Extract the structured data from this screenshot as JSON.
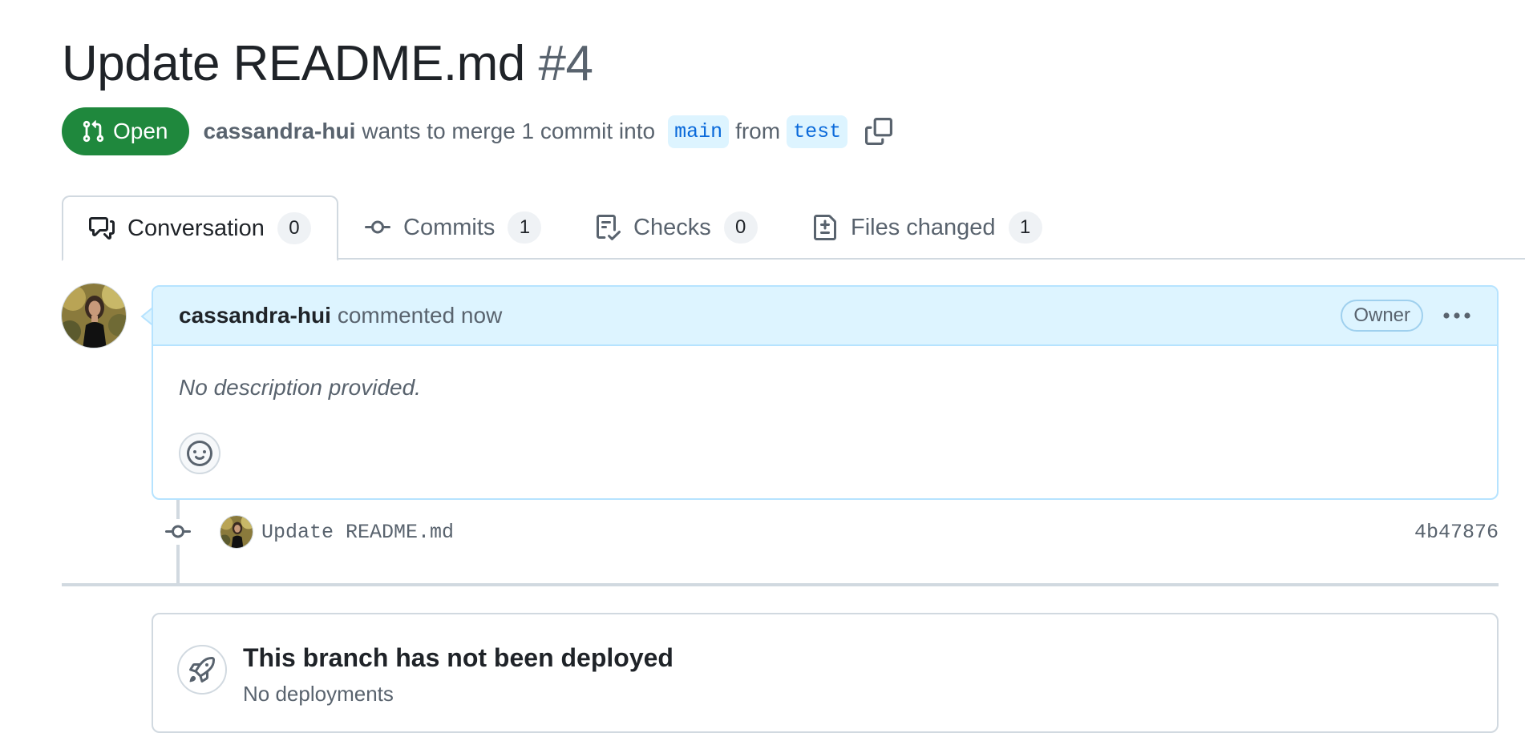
{
  "pr": {
    "title": "Update README.md",
    "number": "#4",
    "state": "Open",
    "author": "cassandra-hui",
    "action_text": "wants to merge 1 commit into",
    "base_branch": "main",
    "from_text": "from",
    "head_branch": "test"
  },
  "tabs": [
    {
      "label": "Conversation",
      "count": "0",
      "icon": "comment-discussion-icon"
    },
    {
      "label": "Commits",
      "count": "1",
      "icon": "git-commit-icon"
    },
    {
      "label": "Checks",
      "count": "0",
      "icon": "checklist-icon"
    },
    {
      "label": "Files changed",
      "count": "1",
      "icon": "file-diff-icon"
    }
  ],
  "comment": {
    "author": "cassandra-hui",
    "meta": "commented now",
    "role_badge": "Owner",
    "body": "No description provided."
  },
  "commit": {
    "message": "Update README.md",
    "sha": "4b47876"
  },
  "deployment": {
    "title": "This branch has not been deployed",
    "subtitle": "No deployments"
  },
  "colors": {
    "open_green": "#1f883d",
    "branch_blue": "#0969da",
    "branch_bg": "#ddf4ff",
    "comment_header_bg": "#ddf4ff"
  }
}
